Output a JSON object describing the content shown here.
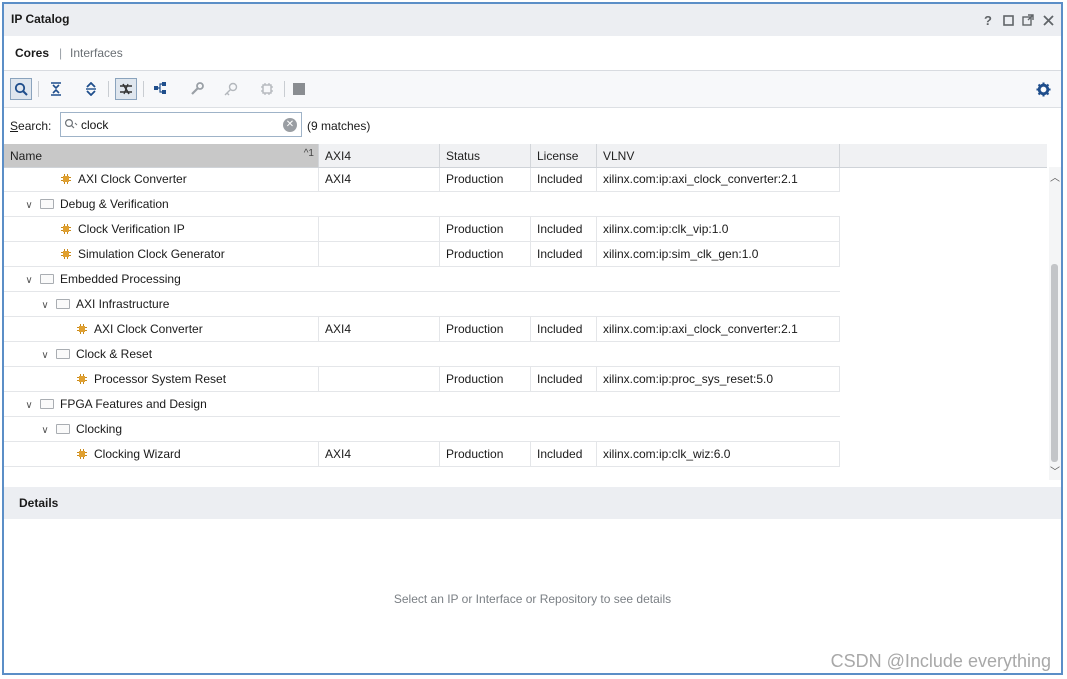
{
  "window": {
    "title": "IP Catalog"
  },
  "window_controls": [
    "help-icon",
    "restore-icon",
    "float-icon",
    "close-icon"
  ],
  "tabs": {
    "cores": "Cores",
    "separator": "|",
    "interfaces": "Interfaces"
  },
  "toolbar_icons": [
    "search-icon",
    "collapse-all-icon",
    "expand-all-icon",
    "filter-icon",
    "hierarchy-icon",
    "customize-icon",
    "license-key-icon",
    "ip-settings-icon",
    "stop-icon",
    "settings-gear-icon"
  ],
  "search": {
    "label_prefix": "S",
    "label_rest": "earch:",
    "value": "clock",
    "matches": "(9 matches)"
  },
  "columns": {
    "name": "Name",
    "sort": "^1",
    "interface": "AXI4",
    "status": "Status",
    "license": "License",
    "vlnv": "VLNV"
  },
  "rows": [
    {
      "name": "AXI Clock Converter",
      "iface": "AXI4",
      "status": "Production",
      "license": "Included",
      "vlnv": "xilinx.com:ip:axi_clock_converter:2.1"
    },
    {
      "name": "Debug & Verification"
    },
    {
      "name": "Clock Verification IP",
      "iface": "",
      "status": "Production",
      "license": "Included",
      "vlnv": "xilinx.com:ip:clk_vip:1.0"
    },
    {
      "name": "Simulation Clock Generator",
      "iface": "",
      "status": "Production",
      "license": "Included",
      "vlnv": "xilinx.com:ip:sim_clk_gen:1.0"
    },
    {
      "name": "Embedded Processing"
    },
    {
      "name": "AXI Infrastructure"
    },
    {
      "name": "AXI Clock Converter",
      "iface": "AXI4",
      "status": "Production",
      "license": "Included",
      "vlnv": "xilinx.com:ip:axi_clock_converter:2.1"
    },
    {
      "name": "Clock & Reset"
    },
    {
      "name": "Processor System Reset",
      "iface": "",
      "status": "Production",
      "license": "Included",
      "vlnv": "xilinx.com:ip:proc_sys_reset:5.0"
    },
    {
      "name": "FPGA Features and Design"
    },
    {
      "name": "Clocking"
    },
    {
      "name": "Clocking Wizard",
      "iface": "AXI4",
      "status": "Production",
      "license": "Included",
      "vlnv": "xilinx.com:ip:clk_wiz:6.0"
    }
  ],
  "details": {
    "title": "Details",
    "placeholder": "Select an IP or Interface or Repository to see details"
  },
  "watermark": "CSDN @Include everything",
  "colors": {
    "frame_border": "#5b8ec7",
    "ip_icon": "#e0a030",
    "panel_bg": "#eceef2"
  }
}
